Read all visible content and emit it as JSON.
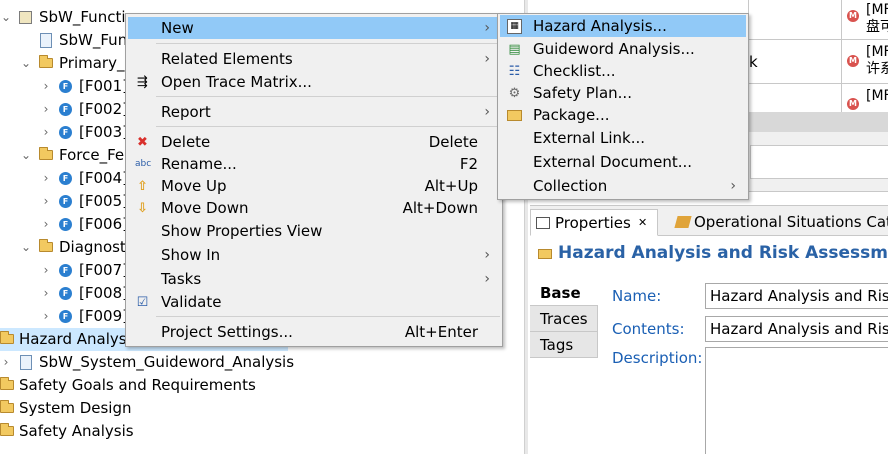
{
  "tree": {
    "items": [
      {
        "label": "SbW_Functi",
        "icon": "package-icon"
      },
      {
        "label": "SbW_Func",
        "icon": "document-icon"
      },
      {
        "label": "Primary_S",
        "icon": "folder-icon"
      },
      {
        "label": "[F001]",
        "icon": "function-icon"
      },
      {
        "label": "[F002]",
        "icon": "function-icon"
      },
      {
        "label": "[F003]",
        "icon": "function-icon"
      },
      {
        "label": "Force_Fe",
        "icon": "folder-icon"
      },
      {
        "label": "[F004]",
        "icon": "function-icon"
      },
      {
        "label": "[F005]",
        "icon": "function-icon"
      },
      {
        "label": "[F006]",
        "icon": "function-icon"
      },
      {
        "label": "Diagnost",
        "icon": "folder-icon"
      },
      {
        "label": "[F007]",
        "icon": "function-icon"
      },
      {
        "label": "[F008]",
        "icon": "function-icon"
      },
      {
        "label": "[F009]",
        "icon": "function-icon"
      },
      {
        "label": "Hazard Analysi",
        "icon": "folder-icon"
      },
      {
        "label": "SbW_System_Guideword_Analysis",
        "icon": "table-icon"
      },
      {
        "label": "Safety Goals and Requirements",
        "icon": "folder-icon"
      },
      {
        "label": "System Design",
        "icon": "folder-icon"
      },
      {
        "label": "Safety Analysis",
        "icon": "folder-icon"
      }
    ],
    "function_badge": "F"
  },
  "context_menu": {
    "new": "New",
    "related_elements": "Related Elements",
    "open_trace_matrix": "Open Trace Matrix...",
    "report": "Report",
    "delete": "Delete",
    "delete_key": "Delete",
    "rename": "Rename...",
    "rename_key": "F2",
    "move_up": "Move Up",
    "move_up_key": "Alt+Up",
    "move_down": "Move Down",
    "move_down_key": "Alt+Down",
    "show_properties_view": "Show Properties View",
    "show_in": "Show In",
    "tasks": "Tasks",
    "validate": "Validate",
    "project_settings": "Project Settings...",
    "project_settings_key": "Alt+Enter",
    "submenu_arrow": "›"
  },
  "new_submenu": {
    "hazard_analysis": "Hazard Analysis...",
    "guideword_analysis": "Guideword Analysis...",
    "checklist": "Checklist...",
    "safety_plan": "Safety Plan...",
    "package": "Package...",
    "external_link": "External Link...",
    "external_document": "External Document...",
    "collection": "Collection"
  },
  "top_grid": {
    "rows": [
      {
        "line1": "[MF",
        "line2": "盘可"
      },
      {
        "line1": "[MF",
        "line2": "许系"
      },
      {
        "line1": "[MF",
        "line2": ""
      }
    ],
    "partial_text": "k",
    "badge": "M"
  },
  "properties": {
    "tab_label": "Properties",
    "tab_close": "✕",
    "tab2_label": "Operational Situations Cata",
    "title": "Hazard Analysis and Risk Assessmen",
    "side_tabs": [
      "Base",
      "Traces",
      "Tags"
    ],
    "name_label": "Name:",
    "name_value": "Hazard Analysis and Risk",
    "contents_label": "Contents:",
    "contents_value": "Hazard Analysis and Risk",
    "description_label": "Description:"
  },
  "colors": {
    "menu_highlight": "#91c9f7",
    "title_blue": "#2a62a6",
    "label_blue": "#1a5fb4"
  }
}
